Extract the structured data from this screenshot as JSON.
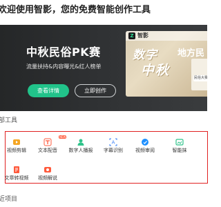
{
  "welcome": "欢迎使用智影，您的免费智能创作工具",
  "banner": {
    "title": "中秋民俗PK赛",
    "subtitle": "流量扶持&内容曝光&红人榜单",
    "btn_primary": "查看详情",
    "btn_secondary": "立即创作",
    "preview": {
      "logo": "Z",
      "app_name": "智影",
      "text_1": "数字",
      "text_2": "地方民",
      "text_3": "中秋",
      "badge": "民俗大赛"
    },
    "carousel_total": 5,
    "carousel_active": 1
  },
  "tools_title": "部工具",
  "tools": [
    {
      "label": "视频剪辑",
      "icon": "video-edit-icon",
      "color": "#f5a623"
    },
    {
      "label": "文本配音",
      "icon": "text-dub-icon",
      "color": "#ff5a3c",
      "badge": "NEW"
    },
    {
      "label": "数字人播报",
      "icon": "digital-human-icon",
      "color": "#2fc38a"
    },
    {
      "label": "字幕识别",
      "icon": "subtitle-icon",
      "color": "#3b82f6"
    },
    {
      "label": "视频审阅",
      "icon": "video-review-icon",
      "color": "#1e90ff"
    },
    {
      "label": "智能抹",
      "icon": "smart-erase-icon",
      "color": "#2fc38a"
    },
    {
      "label": "文章转视频",
      "icon": "article-video-icon",
      "color": "#ff5a3c"
    },
    {
      "label": "视频解说",
      "icon": "video-narration-icon",
      "color": "#ff5a3c"
    }
  ],
  "recent_title": "近项目"
}
